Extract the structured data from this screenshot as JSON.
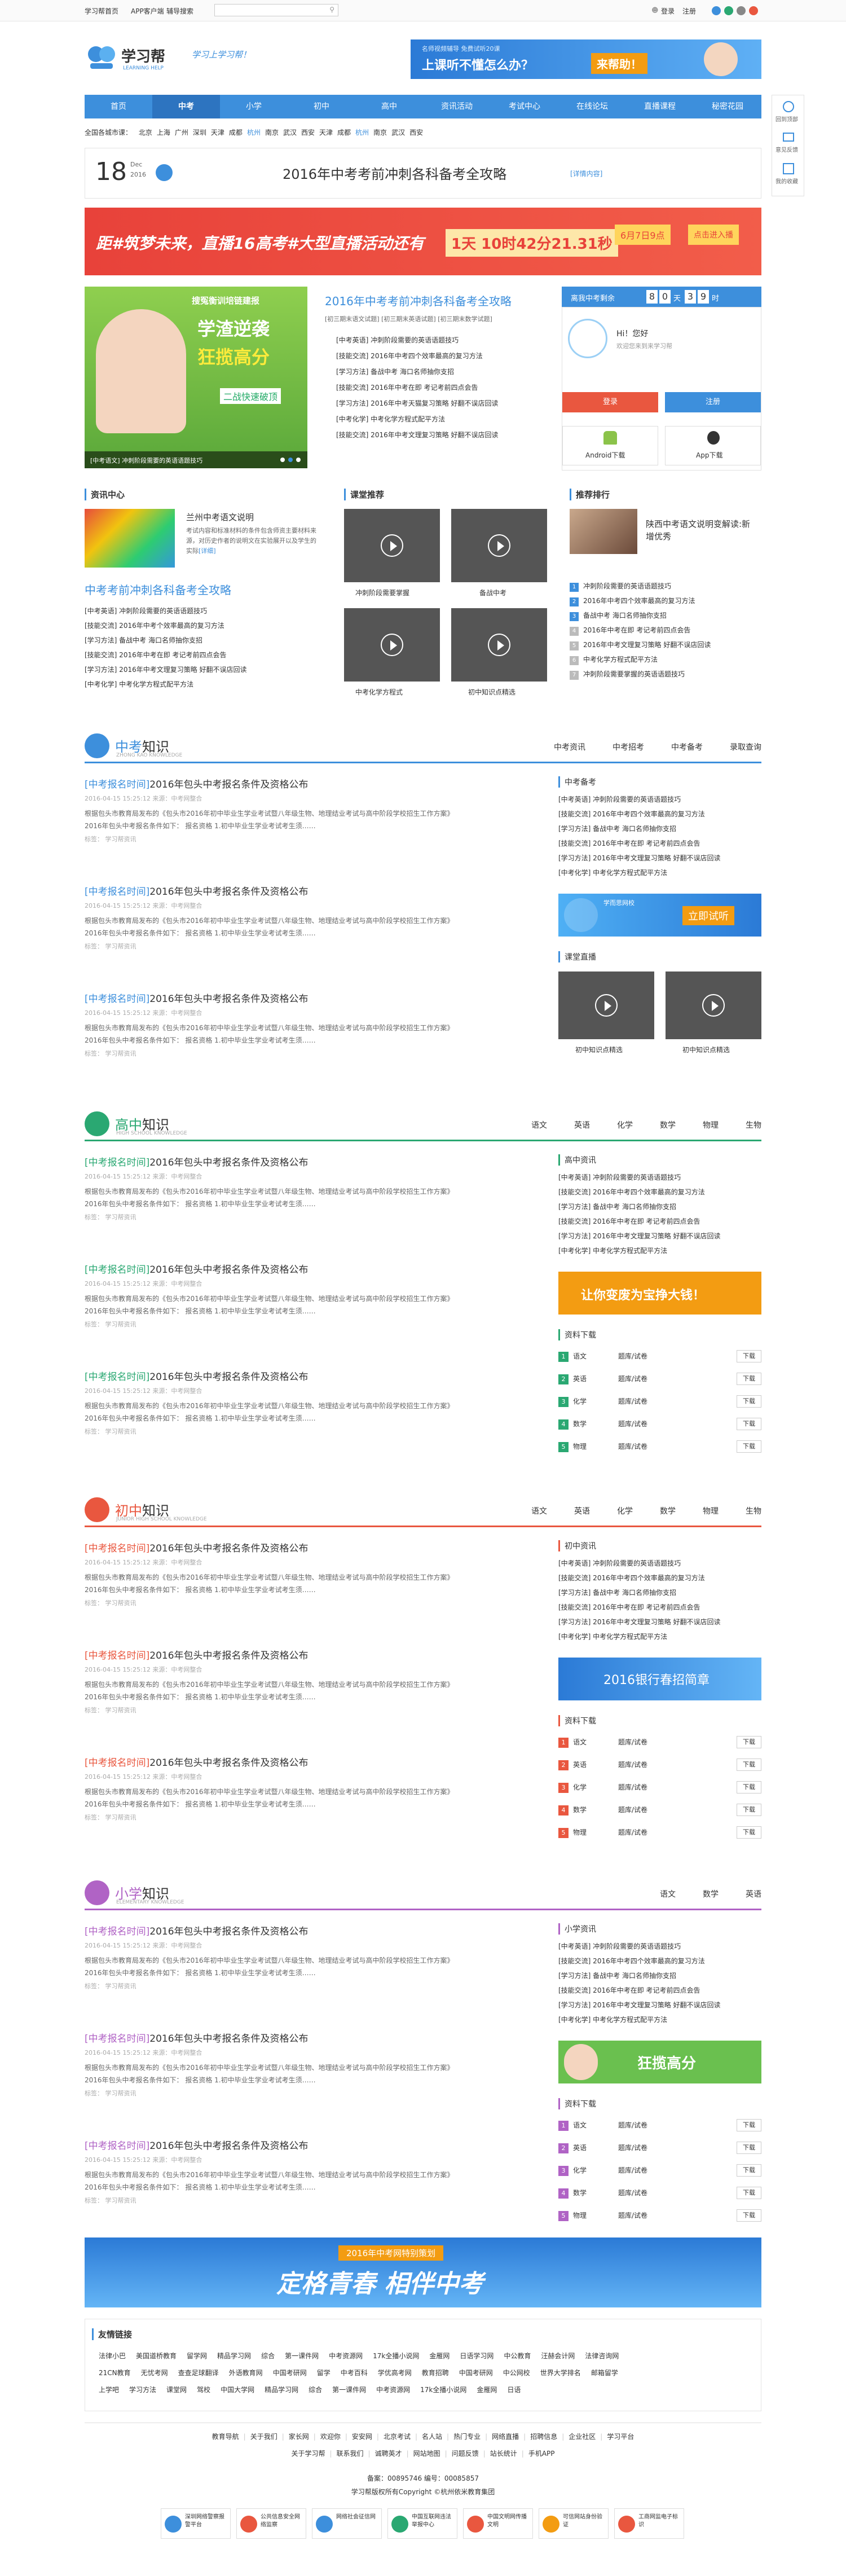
{
  "colors": {
    "blue": "#3d8fdc",
    "green": "#2aa872",
    "red": "#e9573f",
    "purple": "#b063c5",
    "orange": "#f39c12"
  },
  "topbar": {
    "links": [
      "学习帮首页",
      "APP客户端",
      "辅导搜索"
    ],
    "search_placeholder": "",
    "login": "登录",
    "register": "注册"
  },
  "header": {
    "logo_cn": "学习帮",
    "logo_en": "LEARNING HELP",
    "slogan": "学习上学习帮！",
    "ad_text": "上课听不懂怎么办？",
    "ad_btn": "来帮助！",
    "ad_sub": "名师视频辅导 免费试听20课"
  },
  "nav": {
    "items": [
      "首页",
      "中考",
      "小学",
      "初中",
      "高中",
      "资讯活动",
      "考试中心",
      "在线论坛",
      "直播课程",
      "秘密花园"
    ],
    "active": 1
  },
  "cities": {
    "label": "全国各城市课：",
    "list": [
      "北京",
      "上海",
      "广州",
      "深圳",
      "天津",
      "成都",
      "杭州",
      "南京",
      "武汉",
      "西安",
      "天津",
      "成都",
      "杭州",
      "南京",
      "武汉",
      "西安"
    ]
  },
  "headline": {
    "day": "18",
    "month": "Dec",
    "year": "2016",
    "title": "2016年中考考前冲刺各科备考全攻略",
    "tag": "[详情内容]"
  },
  "banner": {
    "text": "距#筑梦未来，直播16高考#大型直播活动还有",
    "countdown": "1天 10时42分21.31秒",
    "date": "6月7日9点",
    "cta": "点击进入播"
  },
  "hero": {
    "overlay1": "搜冤衡训培链建报",
    "overlay2": "学渣逆袭",
    "overlay3": "狂揽高分",
    "overlay4": "二战快速破顶",
    "caption": "[中考语文] 冲刺阶段需要的英语语题技巧",
    "dots": 3
  },
  "focus": {
    "title": "2016年中考考前冲刺各科备考全攻略",
    "sub": [
      "[初三期末语文试题]",
      "[初三期末英语试题]",
      "[初三期末数学试题]"
    ],
    "items": [
      "[中考英语] 冲刺阶段需要的英语语题技巧",
      "[技能交流] 2016年中考四个效率最高的复习方法",
      "[学习方法] 备战中考 海口名师抽你支招",
      "[技能交流] 2016年中考在即 考记考前四点会告",
      "[学习方法] 2016年中考天猫复习策略 好翻不误店回读",
      "[中考化学] 中考化学方程式配平方法",
      "[技能交流] 2016年中考文理复习策略 好翻不误店回读"
    ]
  },
  "side_login": {
    "countdown_label": "离我中考剩余",
    "d1": "8",
    "d2": "0",
    "unit1": "天",
    "d3": "3",
    "d4": "9",
    "unit2": "时",
    "hello": "Hi！您好",
    "welcome": "欢迎您来到来学习帮",
    "login_btn": "登录",
    "register_btn": "注册",
    "android": "Android下载",
    "ios": "App下载"
  },
  "float_bar": [
    "回到顶部",
    "意见反馈",
    "我的收藏"
  ],
  "news_center": {
    "title": "资讯中心",
    "feat_title": "兰州中考语文说明",
    "feat_desc": "考试内容和标准材料的条件包含师资主要材料来源，对历史作者的说明文在实验展开以及学生的实际",
    "feat_more": "[详细]",
    "big_title": "中考考前冲刺各科备考全攻略",
    "items": [
      "[中考英语] 冲刺阶段需要的英语语题技巧",
      "[技能交流] 2016年中考个效率最高的复习方法",
      "[学习方法] 备战中考 海口名师抽你支招",
      "[技能交流] 2016年中考在即 考记考前四点会告",
      "[学习方法] 2016年中考文理复习策略 好翻不误店回读",
      "[中考化学] 中考化学方程式配平方法"
    ]
  },
  "class_rec": {
    "title": "课堂推荐",
    "items": [
      "冲刺阶段需要掌握",
      "备战中考",
      "中考化学方程式",
      "初中知识点精选"
    ]
  },
  "ranking": {
    "title": "推荐排行",
    "feat_title": "陕西中考语文说明变解读:新增优秀",
    "items": [
      "冲刺阶段需要的英语语题技巧",
      "2016年中考四个效率最高的复习方法",
      "备战中考 海口名师抽你支招",
      "2016年中考在即 考记考前四点会告",
      "2016年中考文理复习策略 好翻不误店回读",
      "中考化学方程式配平方法",
      "冲刺阶段需要掌握的英语语题技巧"
    ]
  },
  "sections": [
    {
      "key": "zhongkao",
      "cn1": "中考",
      "cn2": "知识",
      "en": "ZHONG KAO KNOWLEDGE",
      "tabs": [
        "中考资讯",
        "中考招考",
        "中考备考",
        "录取查询"
      ]
    },
    {
      "key": "gaozhong",
      "cn1": "高中",
      "cn2": "知识",
      "en": "HIGH SCHOOL KNOWLEDGE",
      "tabs": [
        "语文",
        "英语",
        "化学",
        "数学",
        "物理",
        "生物"
      ]
    },
    {
      "key": "chuzhong",
      "cn1": "初中",
      "cn2": "知识",
      "en": "JUNIOR HIGH SCHOOL KNOWLEDGE",
      "tabs": [
        "语文",
        "英语",
        "化学",
        "数学",
        "物理",
        "生物"
      ]
    },
    {
      "key": "xiaoxue",
      "cn1": "小学",
      "cn2": "知识",
      "en": "ELEMENTARY KNOWLEDGE",
      "tabs": [
        "语文",
        "数学",
        "英语"
      ]
    }
  ],
  "article": {
    "tag": "[中考报名时间]",
    "title": "2016年包头中考报名条件及资格公布",
    "meta": "2016-04-15 15:25:12  来源：中考网整合",
    "body": "根据包头市教育局发布的《包头市2016年初中毕业生学业考试暨八年级生物、地理结业考试与高中阶段学校招生工作方案》",
    "body2": "2016年包头中考报名条件如下：  报名资格 1.初中毕业生学业考试考生须……",
    "from": "标签： 学习帮资讯"
  },
  "right_lists": {
    "zk_title": "中考备考",
    "gz_title": "高中资讯",
    "cz_title": "初中资讯",
    "xx_title": "小学资讯",
    "items": [
      "[中考英语] 冲刺阶段需要的英语语题技巧",
      "[技能交流] 2016年中考四个效率最高的复习方法",
      "[学习方法] 备战中考 海口名师抽你支招",
      "[技能交流] 2016年中考在即 考记考前四点会告",
      "[学习方法] 2016年中考文理复习策略 好翻不误店回读",
      "[中考化学] 中考化学方程式配平方法"
    ]
  },
  "ads": {
    "trial": "立即试听",
    "trial_small": "学而思网校",
    "bao": "让你变废为宝挣大钱！",
    "bank": "2016银行春招简章",
    "high": "狂揽高分"
  },
  "live": {
    "title": "课堂直播",
    "items": [
      "初中知识点精选",
      "初中知识点精选"
    ]
  },
  "downloads": {
    "title": "资料下载",
    "rows": [
      [
        "1",
        "语文",
        "题库/试卷",
        "下载"
      ],
      [
        "2",
        "英语",
        "题库/试卷",
        "下载"
      ],
      [
        "3",
        "化学",
        "题库/试卷",
        "下载"
      ],
      [
        "4",
        "数学",
        "题库/试卷",
        "下载"
      ],
      [
        "5",
        "物理",
        "题库/试卷",
        "下载"
      ]
    ]
  },
  "big_banner": {
    "line1": "2016年中考网特别策划",
    "line2": "定格青春 相伴中考"
  },
  "friends": {
    "title": "友情链接",
    "rows": [
      [
        "法律小巴",
        "美国道桥教育",
        "留学网",
        "精品学习网",
        "综合",
        "第一课件网",
        "中考资源网",
        "17k全播小说网",
        "金雁网",
        "日语学习网",
        "中公教育",
        "汪赫会计网",
        "法律咨询网"
      ],
      [
        "21CN教育",
        "无忧考网",
        "查查足球翻译",
        "外语教育网",
        "中国考研网",
        "留学",
        "中考百科",
        "学优高考网",
        "教育招聘",
        "中国考研网",
        "中公网校",
        "世界大学排名",
        "邮箱留学"
      ],
      [
        "上学吧",
        "学习方法",
        "课堂网",
        "驾校",
        "中国大学网",
        "精品学习网",
        "综合",
        "第一课件网",
        "中考资源网",
        "17k全播小说网",
        "金雁网",
        "日语"
      ]
    ]
  },
  "footer": {
    "links": [
      "教育导航",
      "关于我们",
      "家长网",
      "欢迎你",
      "安安网",
      "北京考试",
      "名人站",
      "热门专业",
      "网络直播",
      "招聘信息",
      "企业社区",
      "学习平台"
    ],
    "row2": [
      "关于学习帮",
      "联系我们",
      "诚聘英才",
      "网站地图",
      "问题反馈",
      "站长统计",
      "手机APP"
    ],
    "icp": "备案：00895746  编号：00085857",
    "copy": "学习帮版权所有Copyright ©杭州依米教育集团",
    "badges": [
      "深圳网络警察报警平台",
      "公共信息安全网络监察",
      "网络社会征信网",
      "中国互联网违法举报中心",
      "中国文明网传播文明",
      "可信网站身份验证",
      "工商网监电子标识"
    ]
  }
}
